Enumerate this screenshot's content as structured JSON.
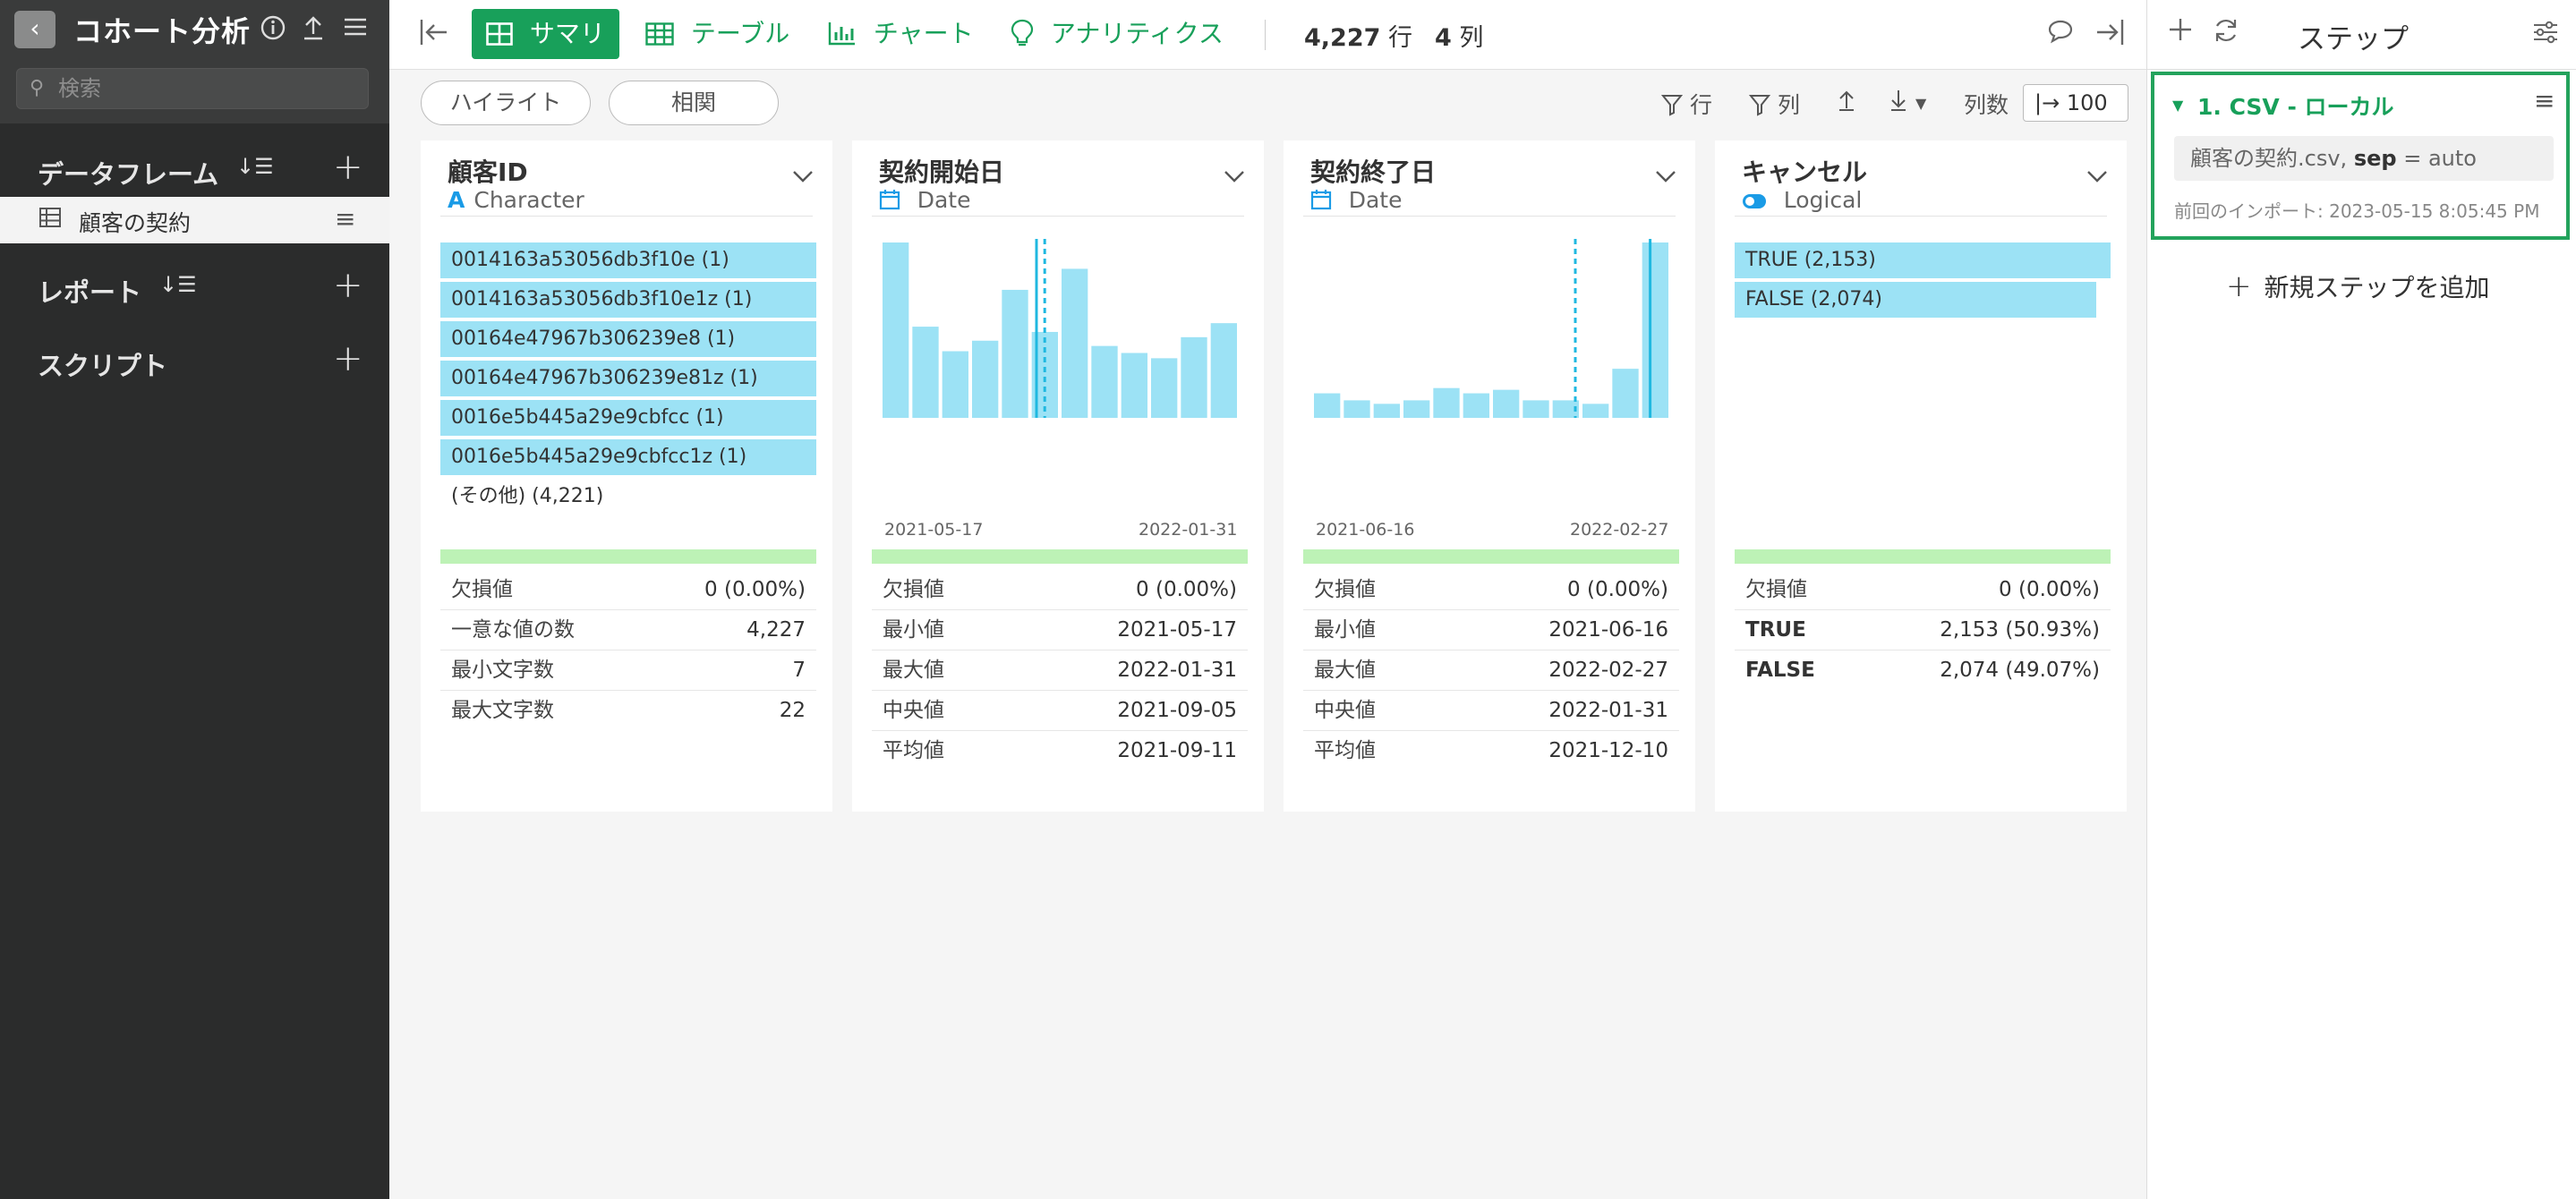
{
  "sidebar": {
    "title": "コホート分析",
    "search_placeholder": "検索",
    "sections": [
      {
        "label": "データフレーム"
      },
      {
        "label": "レポート"
      },
      {
        "label": "スクリプト"
      }
    ],
    "dataframe_item": "顧客の契約"
  },
  "toolbar": {
    "tabs": [
      {
        "label": "サマリ",
        "icon": "grid-icon"
      },
      {
        "label": "テーブル",
        "icon": "table-icon"
      },
      {
        "label": "チャート",
        "icon": "bar-chart-icon"
      },
      {
        "label": "アナリティクス",
        "icon": "lightbulb-icon"
      }
    ],
    "rows_value": "4,227",
    "rows_unit": "行",
    "cols_value": "4",
    "cols_unit": "列"
  },
  "subbar": {
    "highlight": "ハイライト",
    "correlation": "相関",
    "filter_rows": "行",
    "filter_cols": "列",
    "col_count_label": "列数",
    "col_count_value": "100"
  },
  "columns": [
    {
      "name": "顧客ID",
      "type": "Character",
      "type_icon": "A",
      "values": [
        {
          "label": "0014163a53056db3f10e (1)",
          "fraction": 1.0
        },
        {
          "label": "0014163a53056db3f10e1z (1)",
          "fraction": 1.0
        },
        {
          "label": "00164e47967b306239e8 (1)",
          "fraction": 1.0
        },
        {
          "label": "00164e47967b306239e81z (1)",
          "fraction": 1.0
        },
        {
          "label": "0016e5b445a29e9cbfcc (1)",
          "fraction": 1.0
        },
        {
          "label": "0016e5b445a29e9cbfcc1z (1)",
          "fraction": 1.0
        }
      ],
      "other": "(その他) (4,221)",
      "stats": [
        {
          "k": "欠損値",
          "v": "0 (0.00%)"
        },
        {
          "k": "一意な値の数",
          "v": "4,227"
        },
        {
          "k": "最小文字数",
          "v": "7"
        },
        {
          "k": "最大文字数",
          "v": "22"
        }
      ]
    },
    {
      "name": "契約開始日",
      "type": "Date",
      "hist": {
        "heights": [
          1.0,
          0.52,
          0.38,
          0.44,
          0.73,
          0.49,
          0.85,
          0.41,
          0.37,
          0.34,
          0.46,
          0.54
        ],
        "median_pos": 0.435,
        "mean_pos": 0.458,
        "min_label": "2021-05-17",
        "max_label": "2022-01-31"
      },
      "stats": [
        {
          "k": "欠損値",
          "v": "0 (0.00%)"
        },
        {
          "k": "最小値",
          "v": "2021-05-17"
        },
        {
          "k": "最大値",
          "v": "2022-01-31"
        },
        {
          "k": "中央値",
          "v": "2021-09-05"
        },
        {
          "k": "平均値",
          "v": "2021-09-11"
        }
      ]
    },
    {
      "name": "契約終了日",
      "type": "Date",
      "hist": {
        "heights": [
          0.14,
          0.1,
          0.08,
          0.1,
          0.17,
          0.14,
          0.16,
          0.1,
          0.1,
          0.08,
          0.28,
          1.0
        ],
        "median_pos": 0.944,
        "mean_pos": 0.735,
        "min_label": "2021-06-16",
        "max_label": "2022-02-27"
      },
      "stats": [
        {
          "k": "欠損値",
          "v": "0 (0.00%)"
        },
        {
          "k": "最小値",
          "v": "2021-06-16"
        },
        {
          "k": "最大値",
          "v": "2022-02-27"
        },
        {
          "k": "中央値",
          "v": "2022-01-31"
        },
        {
          "k": "平均値",
          "v": "2021-12-10"
        }
      ]
    },
    {
      "name": "キャンセル",
      "type": "Logical",
      "values": [
        {
          "label": "TRUE (2,153)",
          "fraction": 1.0
        },
        {
          "label": "FALSE (2,074)",
          "fraction": 0.963
        }
      ],
      "stats": [
        {
          "k": "欠損値",
          "v": "0 (0.00%)",
          "bold": false
        },
        {
          "k": "TRUE",
          "v": "2,153 (50.93%)",
          "bold": true
        },
        {
          "k": "FALSE",
          "v": "2,074 (49.07%)",
          "bold": true
        }
      ]
    }
  ],
  "steps": {
    "title": "ステップ",
    "step_name": "1. CSV - ローカル",
    "param_file": "顧客の契約.csv,",
    "param_key": "sep",
    "param_rest": "= auto",
    "last_import": "前回のインポート: 2023-05-15 8:05:45 PM",
    "add_step": "新規ステップを追加"
  },
  "colors": {
    "accent": "#18a05a",
    "bar": "#9ce2f5",
    "quality": "#bdf2b6",
    "sidebar_bg": "#2b2c2c",
    "date_icon": "#1a9be6"
  }
}
